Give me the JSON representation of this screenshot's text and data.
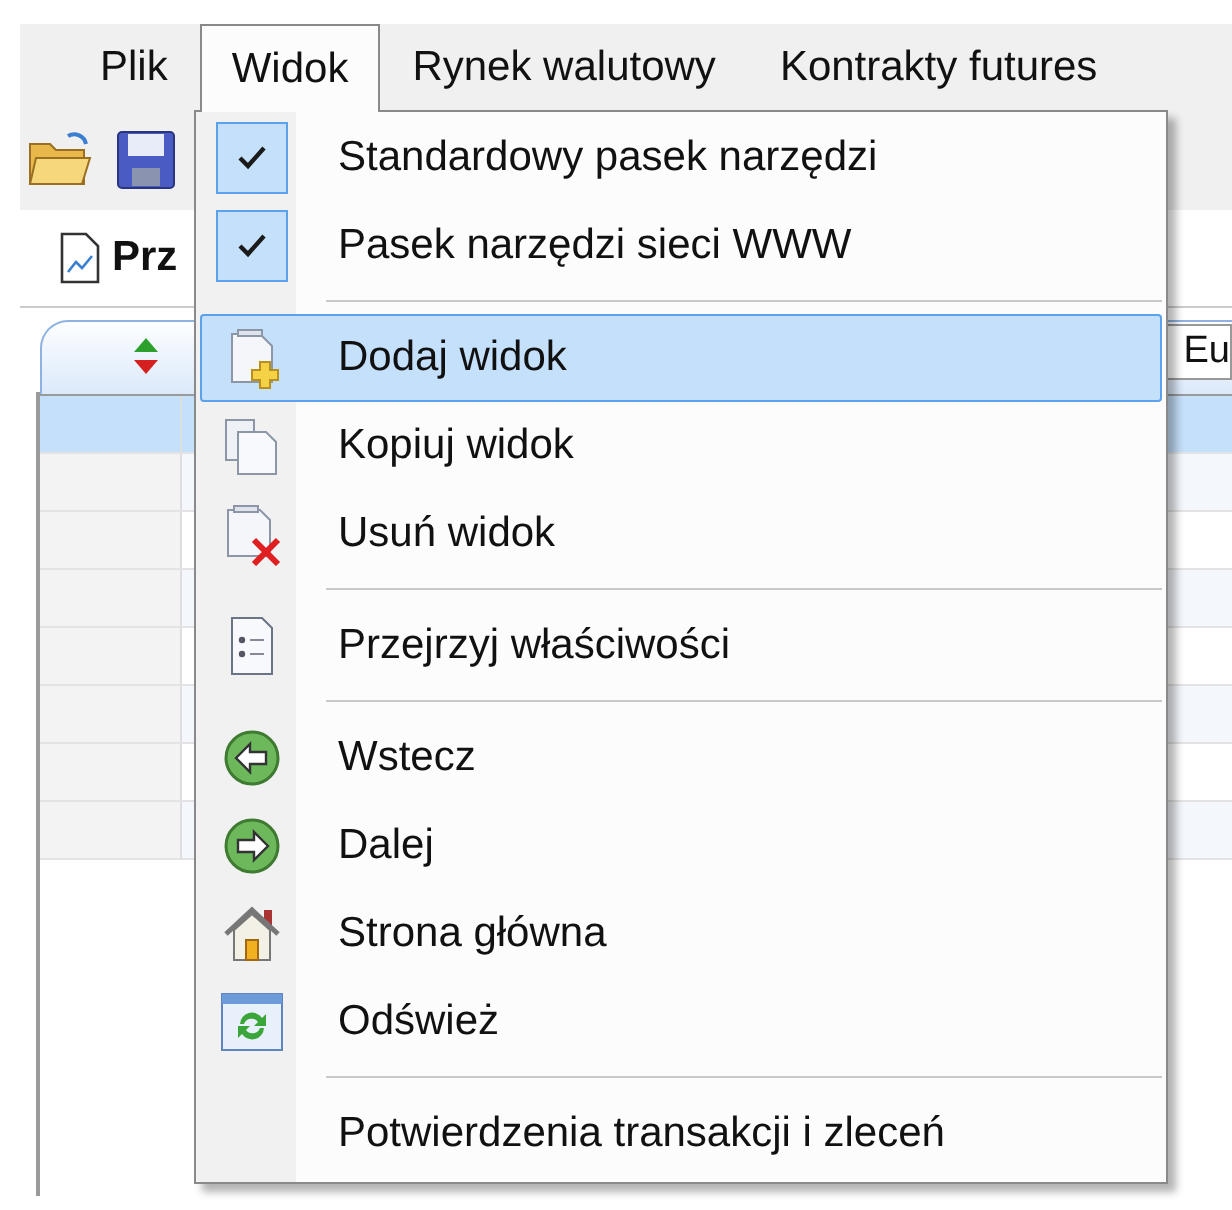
{
  "menubar": [
    {
      "label": "Plik",
      "selected": false
    },
    {
      "label": "Widok",
      "selected": true
    },
    {
      "label": "Rynek walutowy",
      "selected": false
    },
    {
      "label": "Kontrakty futures",
      "selected": false
    }
  ],
  "view_tab": {
    "label": "Prz"
  },
  "secondary_tab": {
    "label": "Eu"
  },
  "grid": {
    "rows": [
      {
        "selected": true
      },
      {
        "selected": false
      },
      {
        "selected": false
      },
      {
        "selected": false
      },
      {
        "selected": false
      },
      {
        "selected": false
      },
      {
        "selected": false
      },
      {
        "selected": false
      }
    ]
  },
  "dropdown": {
    "items": [
      {
        "kind": "check",
        "label": "Standardowy pasek narzędzi",
        "checked": true
      },
      {
        "kind": "check",
        "label": "Pasek narzędzi sieci WWW",
        "checked": true
      },
      {
        "kind": "separator"
      },
      {
        "kind": "command",
        "label": "Dodaj widok",
        "selected": true
      },
      {
        "kind": "command",
        "label": "Kopiuj widok",
        "selected": false
      },
      {
        "kind": "command",
        "label": "Usuń widok",
        "selected": false
      },
      {
        "kind": "separator"
      },
      {
        "kind": "command",
        "label": "Przejrzyj właściwości",
        "selected": false
      },
      {
        "kind": "separator"
      },
      {
        "kind": "command",
        "label": "Wstecz",
        "selected": false
      },
      {
        "kind": "command",
        "label": "Dalej",
        "selected": false
      },
      {
        "kind": "command",
        "label": "Strona główna",
        "selected": false
      },
      {
        "kind": "command",
        "label": "Odśwież",
        "selected": false
      },
      {
        "kind": "separator"
      },
      {
        "kind": "command",
        "label": "Potwierdzenia transakcji i zleceń",
        "selected": false
      }
    ]
  }
}
